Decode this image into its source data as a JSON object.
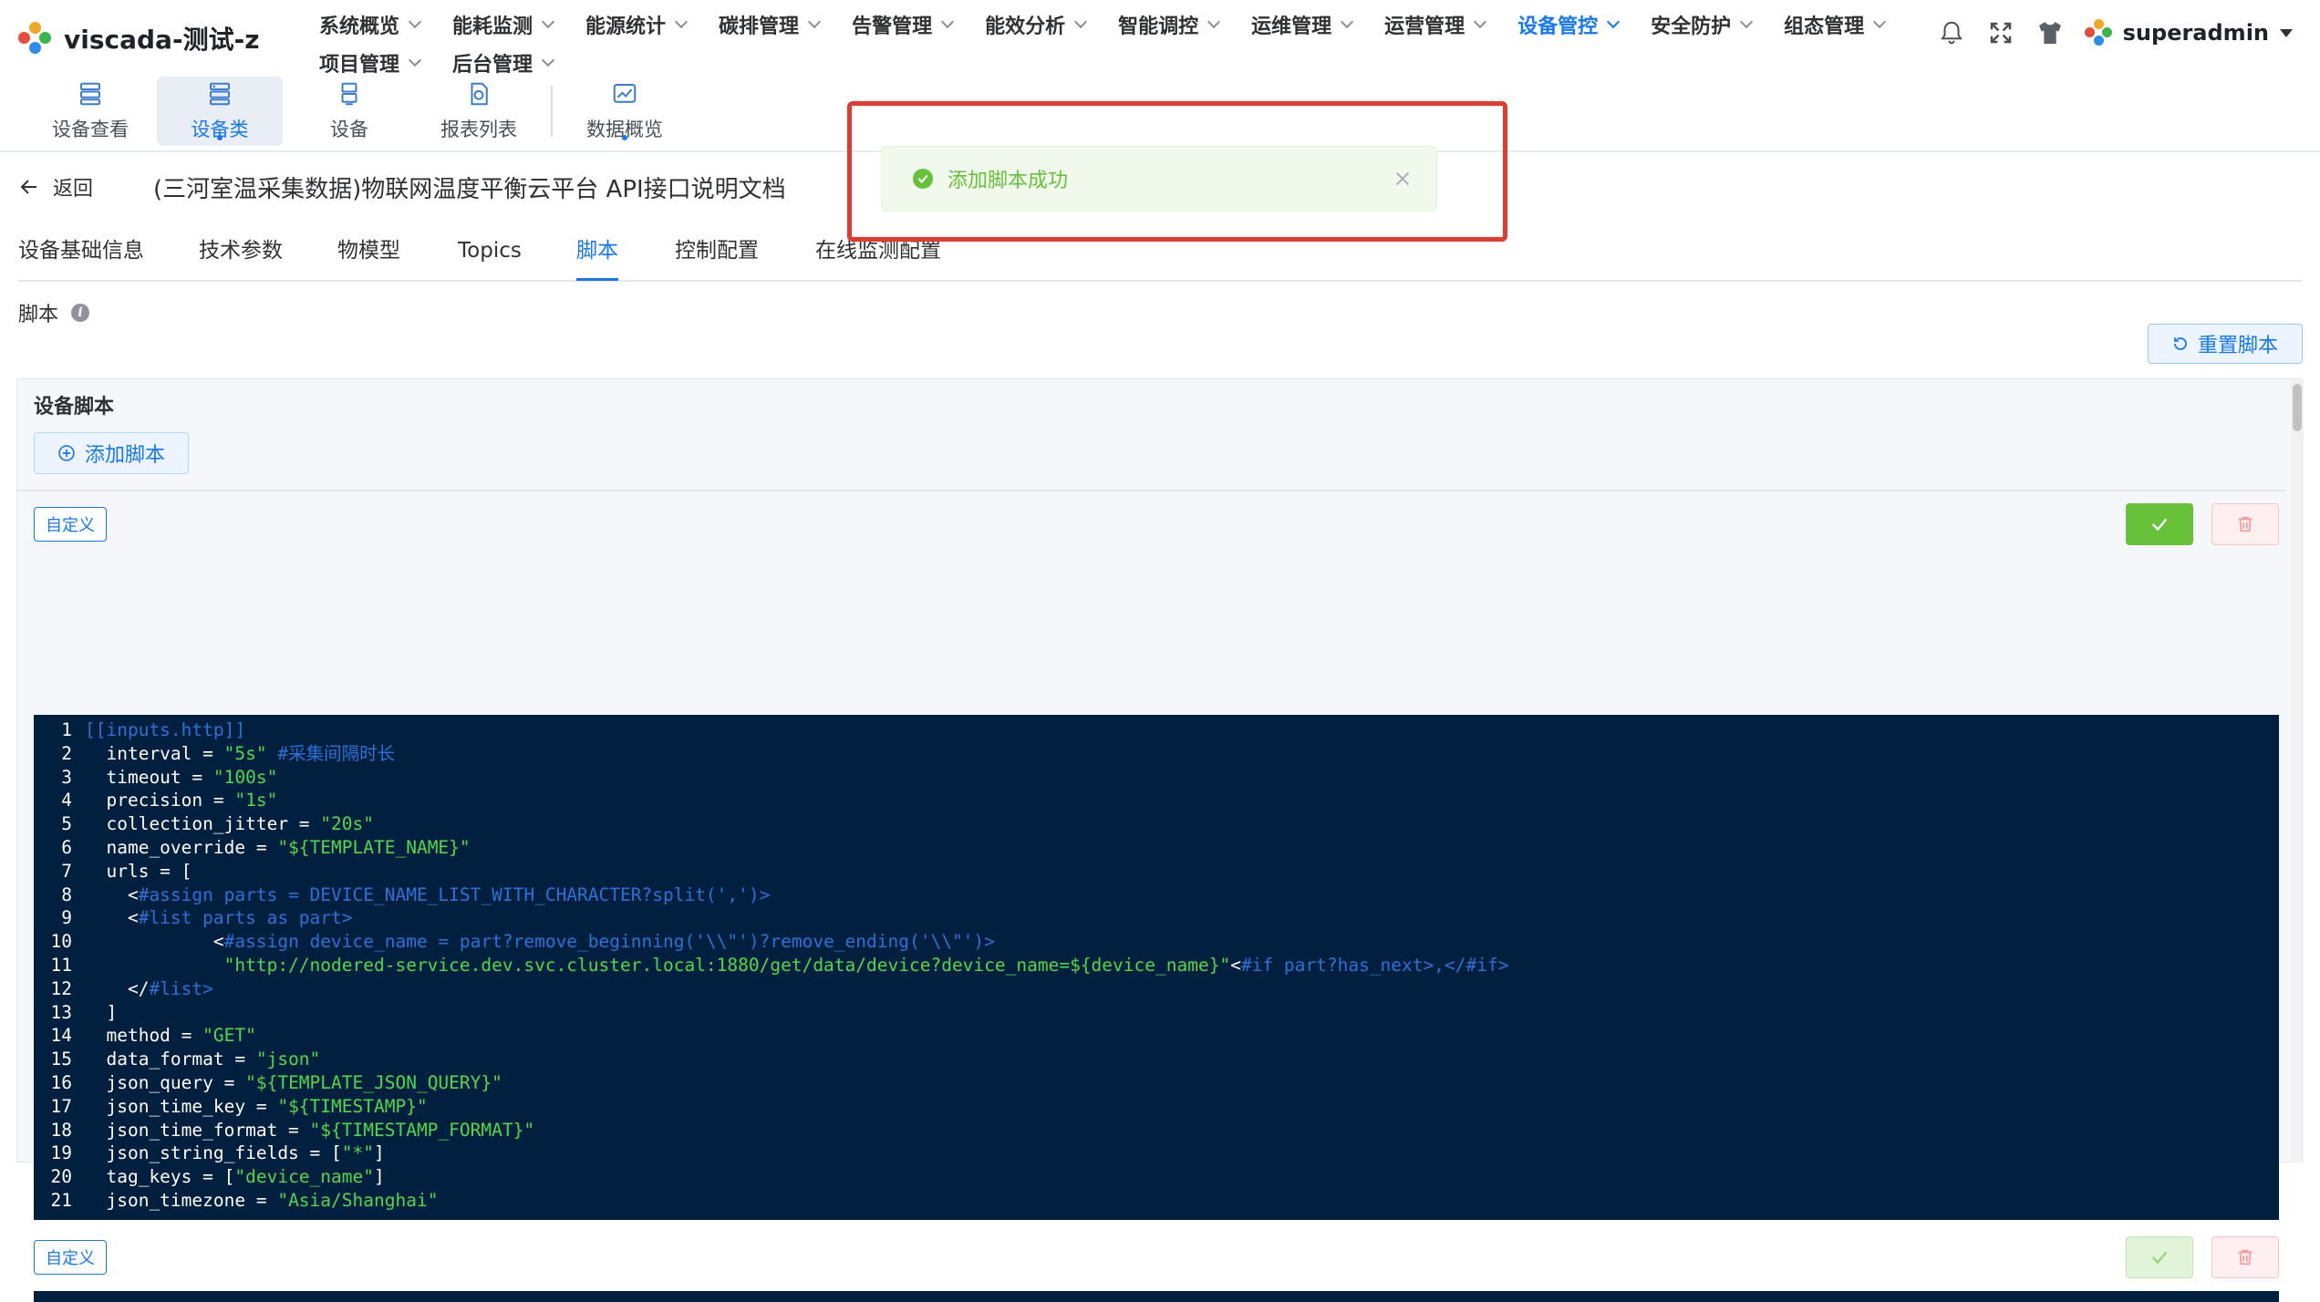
{
  "app": {
    "title": "viscada-测试-z"
  },
  "main_nav": {
    "row1": [
      {
        "label": "系统概览",
        "active": false
      },
      {
        "label": "能耗监测",
        "active": false
      },
      {
        "label": "能源统计",
        "active": false
      },
      {
        "label": "碳排管理",
        "active": false
      },
      {
        "label": "告警管理",
        "active": false
      },
      {
        "label": "能效分析",
        "active": false
      },
      {
        "label": "智能调控",
        "active": false
      },
      {
        "label": "运维管理",
        "active": false
      },
      {
        "label": "运营管理",
        "active": false
      },
      {
        "label": "设备管控",
        "active": true
      },
      {
        "label": "安全防护",
        "active": false
      },
      {
        "label": "组态管理",
        "active": false
      }
    ],
    "row2": [
      {
        "label": "项目管理",
        "active": false
      },
      {
        "label": "后台管理",
        "active": false
      }
    ]
  },
  "user": {
    "name": "superadmin"
  },
  "header_icons": [
    "bell-icon",
    "fullscreen-icon",
    "theme-shirt-icon"
  ],
  "sub_nav": [
    {
      "label": "设备查看",
      "icon": "device-list-icon",
      "active": false
    },
    {
      "label": "设备类",
      "icon": "device-class-icon",
      "active": true
    },
    {
      "label": "设备",
      "icon": "device-icon",
      "active": false
    },
    {
      "label": "报表列表",
      "icon": "report-icon",
      "active": false
    },
    {
      "label": "数据概览",
      "icon": "data-overview-icon",
      "active": false
    }
  ],
  "page": {
    "back_label": "返回",
    "title": "(三河室温采集数据)物联网温度平衡云平台 API接口说明文档",
    "tabs": [
      "设备基础信息",
      "技术参数",
      "物模型",
      "Topics",
      "脚本",
      "控制配置",
      "在线监测配置"
    ],
    "active_tab": "脚本",
    "section_label": "脚本",
    "reset_label": "重置脚本"
  },
  "panel": {
    "title": "设备脚本",
    "add_label": "添加脚本",
    "scripts": [
      {
        "tag": "自定义"
      },
      {
        "tag": "自定义"
      }
    ]
  },
  "code_lines": [
    [
      [
        "kw",
        "[[inputs.http]]"
      ]
    ],
    [
      [
        "def",
        "  interval = "
      ],
      [
        "str",
        "\"5s\""
      ],
      [
        "kw",
        " #采集间隔时长"
      ]
    ],
    [
      [
        "def",
        "  timeout = "
      ],
      [
        "str",
        "\"100s\""
      ]
    ],
    [
      [
        "def",
        "  precision = "
      ],
      [
        "str",
        "\"1s\""
      ]
    ],
    [
      [
        "def",
        "  collection_jitter = "
      ],
      [
        "str",
        "\"20s\""
      ]
    ],
    [
      [
        "def",
        "  name_override = "
      ],
      [
        "str",
        "\"${TEMPLATE_NAME}\""
      ]
    ],
    [
      [
        "def",
        "  urls = ["
      ]
    ],
    [
      [
        "def",
        "    <"
      ],
      [
        "kw",
        "#assign parts = DEVICE_NAME_LIST_WITH_CHARACTER?split(',')>"
      ]
    ],
    [
      [
        "def",
        "    <"
      ],
      [
        "kw",
        "#list parts as part>"
      ]
    ],
    [
      [
        "def",
        "            <"
      ],
      [
        "kw",
        "#assign device_name = part?remove_beginning('\\\\\"')?remove_ending('\\\\\"')>"
      ]
    ],
    [
      [
        "str",
        "             \"http://nodered-service.dev.svc.cluster.local:1880/get/data/device?device_name=${device_name}\""
      ],
      [
        "def",
        "<"
      ],
      [
        "kw",
        "#if part?has_next>,</#if>"
      ]
    ],
    [
      [
        "def",
        "    </"
      ],
      [
        "kw",
        "#list>"
      ]
    ],
    [
      [
        "def",
        "  ]"
      ]
    ],
    [
      [
        "def",
        "  method = "
      ],
      [
        "str",
        "\"GET\""
      ]
    ],
    [
      [
        "def",
        "  data_format = "
      ],
      [
        "str",
        "\"json\""
      ]
    ],
    [
      [
        "def",
        "  json_query = "
      ],
      [
        "str",
        "\"${TEMPLATE_JSON_QUERY}\""
      ]
    ],
    [
      [
        "def",
        "  json_time_key = "
      ],
      [
        "str",
        "\"${TIMESTAMP}\""
      ]
    ],
    [
      [
        "def",
        "  json_time_format = "
      ],
      [
        "str",
        "\"${TIMESTAMP_FORMAT}\""
      ]
    ],
    [
      [
        "def",
        "  json_string_fields = ["
      ],
      [
        "str",
        "\"*\""
      ],
      [
        "def",
        "]"
      ]
    ],
    [
      [
        "def",
        "  tag_keys = ["
      ],
      [
        "str",
        "\"device_name\""
      ],
      [
        "def",
        "]"
      ]
    ],
    [
      [
        "def",
        "  json_timezone = "
      ],
      [
        "str",
        "\"Asia/Shanghai\""
      ]
    ]
  ],
  "toast": {
    "message": "添加脚本成功",
    "type": "success"
  },
  "colors": {
    "accent": "#1677ff",
    "success": "#67c23a",
    "danger": "#f56c6c",
    "editor_bg": "#011f3e",
    "highlight_frame": "#e53a2f"
  }
}
